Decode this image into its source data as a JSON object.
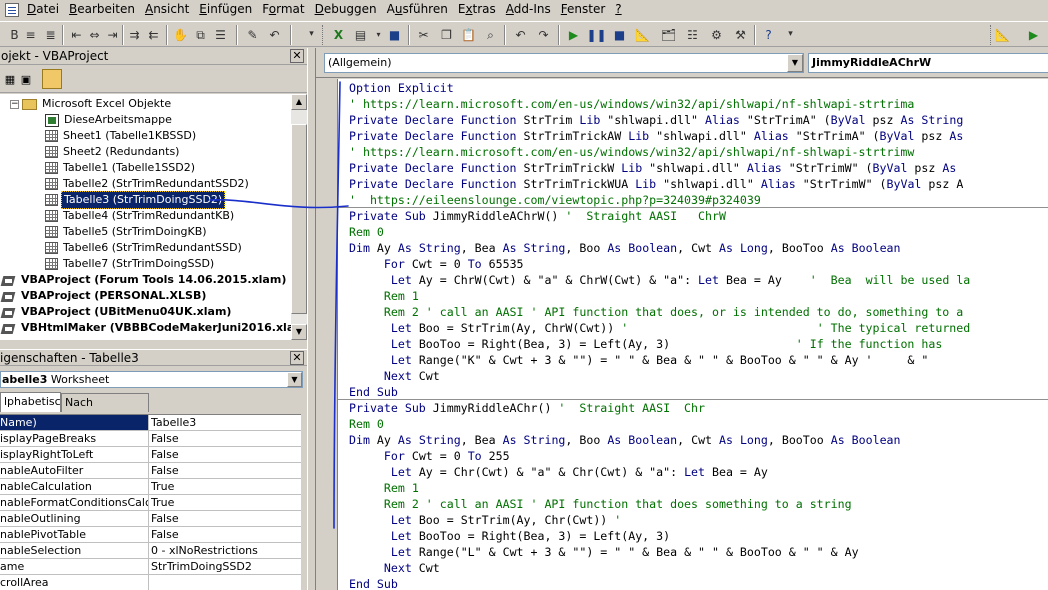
{
  "menu": [
    {
      "label": "Datei",
      "underline": "D"
    },
    {
      "label": "Bearbeiten",
      "underline": "B"
    },
    {
      "label": "Ansicht",
      "underline": "A"
    },
    {
      "label": "Einfügen",
      "underline": "E"
    },
    {
      "label": "Format",
      "underline": "o"
    },
    {
      "label": "Debuggen",
      "underline": "D"
    },
    {
      "label": "Ausführen",
      "underline": "u"
    },
    {
      "label": "Extras",
      "underline": "x"
    },
    {
      "label": "Add-Ins",
      "underline": "A"
    },
    {
      "label": "Fenster",
      "underline": "F"
    },
    {
      "label": "?",
      "underline": "?"
    }
  ],
  "project": {
    "title": "ojekt - VBAProject",
    "tree": [
      {
        "label": "Microsoft Excel Objekte",
        "icon": "folder-icon",
        "indent": 1
      },
      {
        "label": "DieseArbeitsmappe",
        "icon": "workbook-icon",
        "indent": 2
      },
      {
        "label": "Sheet1 (Tabelle1KBSSD)",
        "icon": "sheet-icon",
        "indent": 2
      },
      {
        "label": "Sheet2 (Redundants)",
        "icon": "sheet-icon",
        "indent": 2
      },
      {
        "label": "Tabelle1 (Tabelle1SSD2)",
        "icon": "sheet-icon",
        "indent": 2
      },
      {
        "label": "Tabelle2 (StrTrimRedundantSSD2)",
        "icon": "sheet-icon",
        "indent": 2
      },
      {
        "label": "Tabelle3 (StrTrimDoingSSD2)",
        "icon": "sheet-icon",
        "indent": 2,
        "selected": true
      },
      {
        "label": "Tabelle4 (StrTrimRedundantKB)",
        "icon": "sheet-icon",
        "indent": 2
      },
      {
        "label": "Tabelle5 (StrTrimDoingKB)",
        "icon": "sheet-icon",
        "indent": 2
      },
      {
        "label": "Tabelle6 (StrTrimRedundantSSD)",
        "icon": "sheet-icon",
        "indent": 2
      },
      {
        "label": "Tabelle7 (StrTrimDoingSSD)",
        "icon": "sheet-icon",
        "indent": 2
      },
      {
        "label": "VBAProject (Forum Tools 14.06.2015.xlam)",
        "icon": "project-icon",
        "indent": 0,
        "bold": true
      },
      {
        "label": "VBAProject (PERSONAL.XLSB)",
        "icon": "project-icon",
        "indent": 0,
        "bold": true
      },
      {
        "label": "VBAProject (UBitMenu04UK.xlam)",
        "icon": "project-icon",
        "indent": 0,
        "bold": true
      },
      {
        "label": "VBHtmlMaker (VBBBCodeMakerJuni2016.xla)",
        "icon": "project-icon",
        "indent": 0,
        "bold": true
      }
    ]
  },
  "properties": {
    "title": "igenschaften - Tabelle3",
    "object_name": "abelle3",
    "object_type": "Worksheet",
    "tabs": [
      "lphabetisch",
      "Nach Kategorien"
    ],
    "rows": [
      {
        "name": "Name)",
        "value": "Tabelle3",
        "selected": true
      },
      {
        "name": "isplayPageBreaks",
        "value": "False"
      },
      {
        "name": "isplayRightToLeft",
        "value": "False"
      },
      {
        "name": "nableAutoFilter",
        "value": "False"
      },
      {
        "name": "nableCalculation",
        "value": "True"
      },
      {
        "name": "nableFormatConditionsCalculati",
        "value": "True"
      },
      {
        "name": "nableOutlining",
        "value": "False"
      },
      {
        "name": "nablePivotTable",
        "value": "False"
      },
      {
        "name": "nableSelection",
        "value": "0 - xlNoRestrictions"
      },
      {
        "name": "ame",
        "value": "StrTrimDoingSSD2"
      },
      {
        "name": "crollArea",
        "value": ""
      }
    ]
  },
  "code_window": {
    "object_combo": "(Allgemein)",
    "procedure_combo": "JimmyRiddleAChrW",
    "lines": [
      [
        {
          "t": "Option Explicit",
          "c": "kw"
        }
      ],
      [
        {
          "t": "' https://learn.microsoft.com/en-us/windows/win32/api/shlwapi/nf-shlwapi-strtrima",
          "c": "cm"
        }
      ],
      [
        {
          "t": "Private Declare Function",
          "c": "kw"
        },
        {
          "t": " StrTrim "
        },
        {
          "t": "Lib",
          "c": "kw"
        },
        {
          "t": " \"shlwapi.dll\" "
        },
        {
          "t": "Alias",
          "c": "kw"
        },
        {
          "t": " \"StrTrimA\" ("
        },
        {
          "t": "ByVal",
          "c": "kw"
        },
        {
          "t": " psz "
        },
        {
          "t": "As String",
          "c": "kw"
        }
      ],
      [
        {
          "t": "Private Declare Function",
          "c": "kw"
        },
        {
          "t": " StrTrimTrickAW "
        },
        {
          "t": "Lib",
          "c": "kw"
        },
        {
          "t": " \"shlwapi.dll\" "
        },
        {
          "t": "Alias",
          "c": "kw"
        },
        {
          "t": " \"StrTrimA\" ("
        },
        {
          "t": "ByVal",
          "c": "kw"
        },
        {
          "t": " psz "
        },
        {
          "t": "As",
          "c": "kw"
        }
      ],
      [
        {
          "t": "' https://learn.microsoft.com/en-us/windows/win32/api/shlwapi/nf-shlwapi-strtrimw",
          "c": "cm"
        }
      ],
      [
        {
          "t": "Private Declare Function",
          "c": "kw"
        },
        {
          "t": " StrTrimTrickW "
        },
        {
          "t": "Lib",
          "c": "kw"
        },
        {
          "t": " \"shlwapi.dll\" "
        },
        {
          "t": "Alias",
          "c": "kw"
        },
        {
          "t": " \"StrTrimW\" ("
        },
        {
          "t": "ByVal",
          "c": "kw"
        },
        {
          "t": " psz "
        },
        {
          "t": "As",
          "c": "kw"
        }
      ],
      [
        {
          "t": "Private Declare Function",
          "c": "kw"
        },
        {
          "t": " StrTrimTrickWUA "
        },
        {
          "t": "Lib",
          "c": "kw"
        },
        {
          "t": " \"shlwapi.dll\" "
        },
        {
          "t": "Alias",
          "c": "kw"
        },
        {
          "t": " \"StrTrimW\" ("
        },
        {
          "t": "ByVal",
          "c": "kw"
        },
        {
          "t": " psz A"
        }
      ],
      [
        {
          "t": "'  https://eileenslounge.com/viewtopic.php?p=324039#p324039",
          "c": "cm"
        }
      ],
      [
        {
          "t": "Private Sub",
          "c": "kw"
        },
        {
          "t": " JimmyRiddleAChrW() "
        },
        {
          "t": "'  Straight AASI   ChrW",
          "c": "cm"
        }
      ],
      [
        {
          "t": "Rem 0",
          "c": "cm"
        }
      ],
      [
        {
          "t": "Dim",
          "c": "kw"
        },
        {
          "t": " Ay "
        },
        {
          "t": "As String",
          "c": "kw"
        },
        {
          "t": ", Bea "
        },
        {
          "t": "As String",
          "c": "kw"
        },
        {
          "t": ", Boo "
        },
        {
          "t": "As Boolean",
          "c": "kw"
        },
        {
          "t": ", Cwt "
        },
        {
          "t": "As Long",
          "c": "kw"
        },
        {
          "t": ", BooToo "
        },
        {
          "t": "As Boolean",
          "c": "kw"
        }
      ],
      [
        {
          "t": "     "
        },
        {
          "t": "For",
          "c": "kw"
        },
        {
          "t": " Cwt = 0 "
        },
        {
          "t": "To",
          "c": "kw"
        },
        {
          "t": " 65535"
        }
      ],
      [
        {
          "t": "      "
        },
        {
          "t": "Let",
          "c": "kw"
        },
        {
          "t": " Ay = ChrW(Cwt) & \"a\" & ChrW(Cwt) & \"a\": "
        },
        {
          "t": "Let",
          "c": "kw"
        },
        {
          "t": " Bea = Ay    "
        },
        {
          "t": "'  Bea  will be used la",
          "c": "cm"
        }
      ],
      [
        {
          "t": "     "
        },
        {
          "t": "Rem 1",
          "c": "cm"
        }
      ],
      [
        {
          "t": "     "
        },
        {
          "t": "Rem 2 ' call an AASI ' API function that does, or is intended to do, something to a",
          "c": "cm"
        }
      ],
      [
        {
          "t": "      "
        },
        {
          "t": "Let",
          "c": "kw"
        },
        {
          "t": " Boo = StrTrim(Ay, ChrW(Cwt)) "
        },
        {
          "t": "'                           ' The typical returned",
          "c": "cm"
        }
      ],
      [
        {
          "t": "      "
        },
        {
          "t": "Let",
          "c": "kw"
        },
        {
          "t": " BooToo = Right(Bea, 3) = Left(Ay, 3)                  "
        },
        {
          "t": "' If the function has",
          "c": "cm"
        }
      ],
      [
        {
          "t": "      "
        },
        {
          "t": "Let",
          "c": "kw"
        },
        {
          "t": " Range(\"K\" & Cwt + 3 & \"\") = \" \" & Bea & \" \" & BooToo & \" \" & Ay '     & \""
        }
      ],
      [
        {
          "t": "     "
        },
        {
          "t": "Next",
          "c": "kw"
        },
        {
          "t": " Cwt"
        }
      ],
      [
        {
          "t": "End Sub",
          "c": "kw"
        }
      ],
      [
        {
          "t": "Private Sub",
          "c": "kw"
        },
        {
          "t": " JimmyRiddleAChr() "
        },
        {
          "t": "'  Straight AASI  Chr",
          "c": "cm"
        }
      ],
      [
        {
          "t": "Rem 0",
          "c": "cm"
        }
      ],
      [
        {
          "t": "Dim",
          "c": "kw"
        },
        {
          "t": " Ay "
        },
        {
          "t": "As String",
          "c": "kw"
        },
        {
          "t": ", Bea "
        },
        {
          "t": "As String",
          "c": "kw"
        },
        {
          "t": ", Boo "
        },
        {
          "t": "As Boolean",
          "c": "kw"
        },
        {
          "t": ", Cwt "
        },
        {
          "t": "As Long",
          "c": "kw"
        },
        {
          "t": ", BooToo "
        },
        {
          "t": "As Boolean",
          "c": "kw"
        }
      ],
      [
        {
          "t": "     "
        },
        {
          "t": "For",
          "c": "kw"
        },
        {
          "t": " Cwt = 0 "
        },
        {
          "t": "To",
          "c": "kw"
        },
        {
          "t": " 255"
        }
      ],
      [
        {
          "t": "      "
        },
        {
          "t": "Let",
          "c": "kw"
        },
        {
          "t": " Ay = Chr(Cwt) & \"a\" & Chr(Cwt) & \"a\": "
        },
        {
          "t": "Let",
          "c": "kw"
        },
        {
          "t": " Bea = Ay"
        }
      ],
      [
        {
          "t": "     "
        },
        {
          "t": "Rem 1",
          "c": "cm"
        }
      ],
      [
        {
          "t": "     "
        },
        {
          "t": "Rem 2 ' call an AASI ' API function that does something to a string",
          "c": "cm"
        }
      ],
      [
        {
          "t": "      "
        },
        {
          "t": "Let",
          "c": "kw"
        },
        {
          "t": " Boo = StrTrim(Ay, Chr(Cwt)) "
        },
        {
          "t": "'",
          "c": "cm"
        }
      ],
      [
        {
          "t": "      "
        },
        {
          "t": "Let",
          "c": "kw"
        },
        {
          "t": " BooToo = Right(Bea, 3) = Left(Ay, 3)"
        }
      ],
      [
        {
          "t": "      "
        },
        {
          "t": "Let",
          "c": "kw"
        },
        {
          "t": " Range(\"L\" & Cwt + 3 & \"\") = \" \" & Bea & \" \" & BooToo & \" \" & Ay"
        }
      ],
      [
        {
          "t": "     "
        },
        {
          "t": "Next",
          "c": "kw"
        },
        {
          "t": " Cwt"
        }
      ],
      [
        {
          "t": "End Sub",
          "c": "kw"
        }
      ]
    ],
    "separators_after": [
      7,
      19
    ]
  },
  "colors": {
    "keyword": "#000080",
    "comment": "#007000",
    "selection": "#0a246a",
    "annotation": "#1a2fc9"
  }
}
